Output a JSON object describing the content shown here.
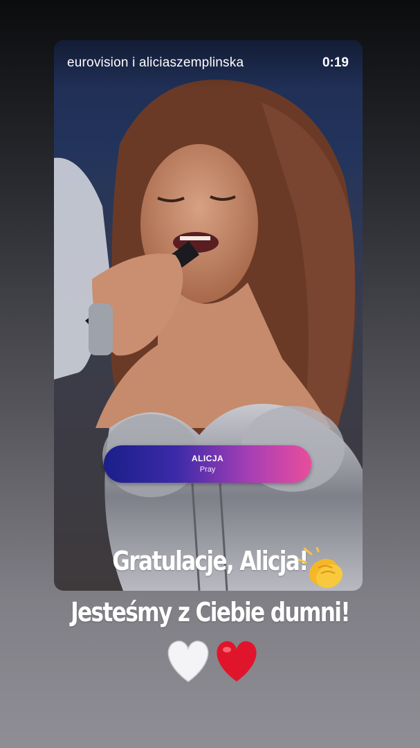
{
  "story": {
    "account_label": "eurovision i aliciaszemplinska",
    "timer": "0:19"
  },
  "lower_third": {
    "name": "ALICJA",
    "song": "Pray"
  },
  "caption": {
    "line1": "Gratulacje, Alicja!",
    "line2": "Jesteśmy z Ciebie dumni!"
  },
  "emojis": [
    "clapping-hands",
    "white-heart",
    "red-heart"
  ],
  "colors": {
    "lower_third_start": "#1a1f8a",
    "lower_third_end": "#e94d9c"
  }
}
